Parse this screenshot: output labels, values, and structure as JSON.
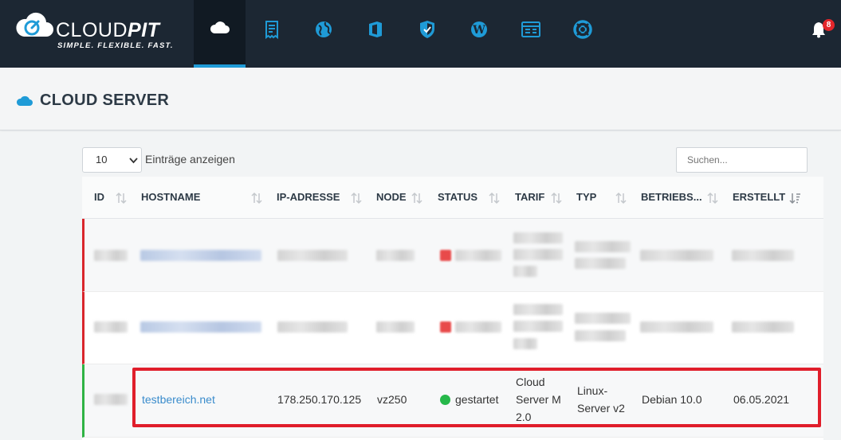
{
  "brand": {
    "name_light": "CLOUD",
    "name_bold": "PIT",
    "tagline": "SIMPLE. FLEXIBLE. FAST."
  },
  "nav": {
    "items": [
      {
        "icon": "cloud-icon",
        "active": true
      },
      {
        "icon": "receipt-icon",
        "active": false
      },
      {
        "icon": "globe-icon",
        "active": false
      },
      {
        "icon": "office-icon",
        "active": false
      },
      {
        "icon": "shield-icon",
        "active": false
      },
      {
        "icon": "wordpress-icon",
        "active": false
      },
      {
        "icon": "browser-window-icon",
        "active": false
      },
      {
        "icon": "lifebuoy-icon",
        "active": false
      }
    ],
    "notifications_count": "8"
  },
  "page": {
    "title": "CLOUD SERVER"
  },
  "controls": {
    "page_length_value": "10",
    "page_length_label": "Einträge anzeigen",
    "search_placeholder": "Suchen..."
  },
  "table": {
    "columns": [
      "ID",
      "HOSTNAME",
      "IP-ADRESSE",
      "NODE",
      "STATUS",
      "TARIF",
      "TYP",
      "BETRIEBS...",
      "ERSTELLT"
    ],
    "visible_row": {
      "hostname": "testbereich.net",
      "ip": "178.250.170.125",
      "node": "vz250",
      "status": "gestartet",
      "tarif": "Cloud Server M 2.0",
      "typ": "Linux-Server v2",
      "os": "Debian 10.0",
      "created": "06.05.2021"
    }
  },
  "colors": {
    "navbar": "#1c2733",
    "accent": "#1f9bd7",
    "status_started": "#26b84a",
    "status_stopped": "#e84a4a",
    "row_marker_red": "#d9262c",
    "row_marker_green": "#2fb344",
    "highlight": "#e01e2b"
  }
}
